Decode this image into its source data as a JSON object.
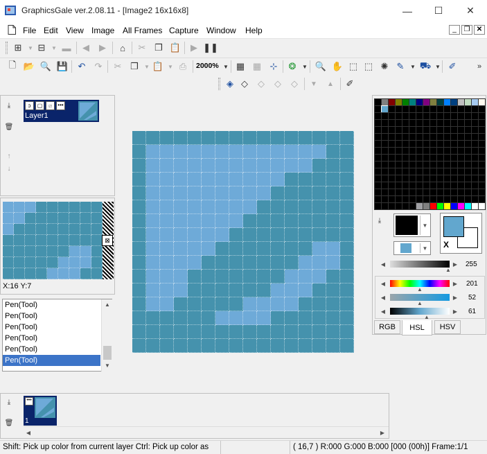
{
  "window": {
    "title": "GraphicsGale ver.2.08.11 - [Image2 16x16x8]",
    "minimize_glyph": "—",
    "maximize_glyph": "☐",
    "close_glyph": "✕"
  },
  "menu": [
    "File",
    "Edit",
    "View",
    "Image",
    "All Frames",
    "Capture",
    "Window",
    "Help"
  ],
  "toolbar": {
    "zoom_value": "2000%"
  },
  "layers": {
    "layer_name": "Layer1"
  },
  "preview": {
    "coords": "X:16 Y:7"
  },
  "history": {
    "items": [
      "Pen(Tool)",
      "Pen(Tool)",
      "Pen(Tool)",
      "Pen(Tool)",
      "Pen(Tool)",
      "Pen(Tool)"
    ],
    "selected_index": 5
  },
  "frames": {
    "frame_number": "1"
  },
  "color_panel": {
    "transparent_mark": "X",
    "slider_gray_value": "255",
    "hue_value": "201",
    "saturation_value": "52",
    "lightness_value": "61",
    "tabs": [
      "RGB",
      "HSL",
      "HSV"
    ],
    "active_tab": "HSL"
  },
  "statusbar": {
    "hint": "Shift: Pick up color from current layer  Ctrl: Pick up color as",
    "info": "( 16,7 ) R:000 G:000 B:000  [000 (00h)]  Frame:1/1"
  },
  "canvas": {
    "pixel_grid": [
      "0000000000000000",
      "0111111111111100",
      "0111111111111000",
      "0111111111100000",
      "0111111111000000",
      "0111111110000000",
      "0111111100000000",
      "0111111000000000",
      "0111110000000110",
      "0111100000001110",
      "0111000000011100",
      "0111000000111000",
      "0110000011110000",
      "0000001111000000",
      "0000000000000000",
      "0000000000000000"
    ]
  },
  "colors": {
    "pixel_dark": "#4592ad",
    "pixel_light": "#6eaad8",
    "selection": "#0a246a",
    "primary": "#000000",
    "secondary": "#62a7ce",
    "history_selected": "#3c74c8"
  },
  "palette_top_row": [
    "#000000",
    "#808080",
    "#800000",
    "#808000",
    "#008000",
    "#008080",
    "#000080",
    "#800080",
    "#808040",
    "#004040",
    "#0080ff",
    "#004080",
    "#c0c0c0",
    "#c0dcc0",
    "#a6caf0",
    "#fffbf0"
  ],
  "palette_bottom_row": [
    "#000000",
    "#000000",
    "#000000",
    "#000000",
    "#000000",
    "#000000",
    "#a0a0a4",
    "#808080",
    "#ff0000",
    "#00ff00",
    "#ffff00",
    "#0000ff",
    "#ff00ff",
    "#00ffff",
    "#ffffff",
    "#ffffff"
  ]
}
